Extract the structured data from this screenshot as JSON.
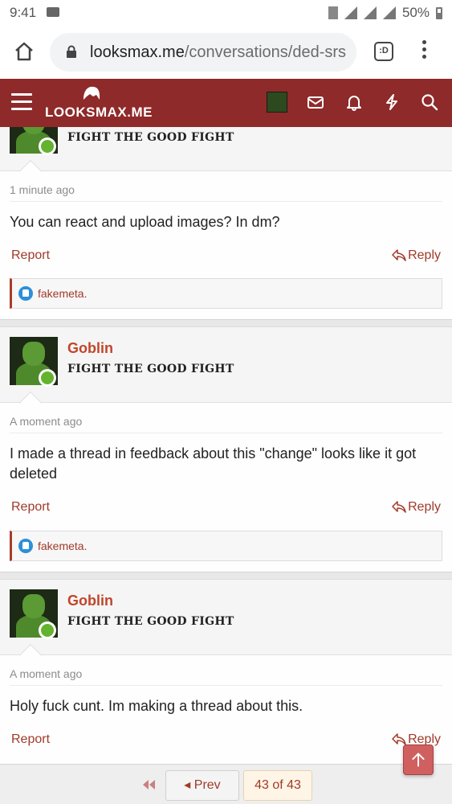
{
  "status_bar": {
    "time": "9:41",
    "battery": "50%"
  },
  "browser": {
    "url_domain": "looksmax.me",
    "url_path": "/conversations/ded-srs",
    "tabs_label": ":D"
  },
  "navbar": {
    "logo_text": "LOOKSMAX.ME",
    "brand_color": "#8f2a2a"
  },
  "posts": [
    {
      "user_title": "FIGHT THE GOOD FIGHT",
      "time": "1 minute ago",
      "message": "You can react and upload images? In dm?",
      "report_label": "Report",
      "reply_label": "Reply",
      "reaction_user": "fakemeta."
    },
    {
      "username": "Goblin",
      "user_title": "FIGHT THE GOOD FIGHT",
      "time": "A moment ago",
      "message": "I made a thread in feedback about this \"change\" looks like it got deleted",
      "report_label": "Report",
      "reply_label": "Reply",
      "reaction_user": "fakemeta."
    },
    {
      "username": "Goblin",
      "user_title": "FIGHT THE GOOD FIGHT",
      "time": "A moment ago",
      "message": "Holy fuck cunt. Im making a thread about this.",
      "report_label": "Report",
      "reply_label": "Reply"
    }
  ],
  "pagination": {
    "prev_label": "Prev",
    "page_label": "43 of 43"
  },
  "icons": [
    "mail-icon",
    "home-icon",
    "lock-icon",
    "hamburger-icon",
    "envelope-icon",
    "bell-icon",
    "bolt-icon",
    "search-icon",
    "reply-icon",
    "like-icon",
    "first-page-icon",
    "scroll-top-icon"
  ]
}
